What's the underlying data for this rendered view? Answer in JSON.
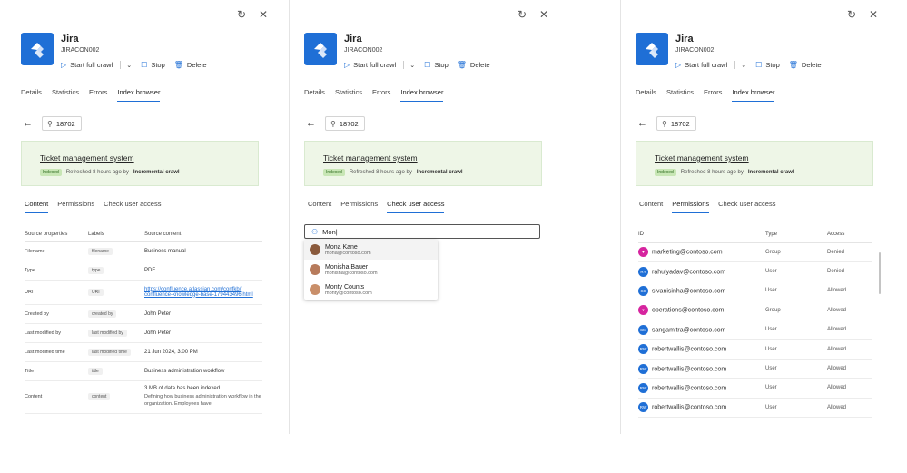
{
  "app": {
    "title": "Jira",
    "id": "JIRACON002",
    "actions": {
      "start_crawl": "Start full crawl",
      "stop": "Stop",
      "delete": "Delete"
    },
    "tabs": [
      "Details",
      "Statistics",
      "Errors",
      "Index browser"
    ],
    "active_tab": "Index browser"
  },
  "search": {
    "value": "18702"
  },
  "document": {
    "title": "Ticket management system",
    "badge": "Indexed",
    "refreshed": "Refreshed 8 hours ago by",
    "crawl": "Incremental crawl"
  },
  "subtabs": [
    "Content",
    "Permissions",
    "Check user access"
  ],
  "content_table": {
    "headers": [
      "Source properties",
      "Labels",
      "Source content"
    ],
    "rows": [
      {
        "prop": "Filename",
        "label": "filename",
        "value": "Business manual"
      },
      {
        "prop": "Type",
        "label": "type",
        "value": "PDF"
      },
      {
        "prop": "URI",
        "label": "URI",
        "value": "https://confluence.atlassian.com/confkb/confluence-knowledge-base-179443496.html",
        "value_line1": "https://confluence.atlassian.com/confkb/",
        "value_line2": "confluence-knowledge-base-179443496.html"
      },
      {
        "prop": "Created by",
        "label": "created by",
        "value": "John Peter"
      },
      {
        "prop": "Last modified by",
        "label": "last modified by",
        "value": "John Peter"
      },
      {
        "prop": "Last modified time",
        "label": "last modified time",
        "value": "21 Jun 2024, 3:00 PM"
      },
      {
        "prop": "Title",
        "label": "title",
        "value": "Business administration workflow"
      },
      {
        "prop": "Content",
        "label": "content",
        "value": "3 MB of data has been indexed",
        "desc": "Defining how business administration workflow in the organization. Employees have"
      }
    ]
  },
  "user_access": {
    "input_value": "Mon|",
    "suggestions": [
      {
        "name": "Mona Kane",
        "email": "mona@contoso.com"
      },
      {
        "name": "Monisha Bauer",
        "email": "monisha@contoso.com"
      },
      {
        "name": "Monty Counts",
        "email": "monty@contoso.com"
      }
    ]
  },
  "permissions": {
    "headers": [
      "ID",
      "Type",
      "Access"
    ],
    "rows": [
      {
        "id": "marketing@contoso.com",
        "initials": "",
        "type": "Group",
        "access": "Denied",
        "color": "#d6249f"
      },
      {
        "id": "rahulyadav@contoso.com",
        "initials": "RY",
        "type": "User",
        "access": "Denied",
        "color": "#1f6fd6"
      },
      {
        "id": "sivanisinha@contoso.com",
        "initials": "SS",
        "type": "User",
        "access": "Allowed",
        "color": "#1f6fd6"
      },
      {
        "id": "operations@contoso.com",
        "initials": "",
        "type": "Group",
        "access": "Allowed",
        "color": "#d6249f"
      },
      {
        "id": "sangamitra@contoso.com",
        "initials": "SM",
        "type": "User",
        "access": "Allowed",
        "color": "#1f6fd6"
      },
      {
        "id": "robertwallis@contoso.com",
        "initials": "RW",
        "type": "User",
        "access": "Allowed",
        "color": "#1f6fd6"
      },
      {
        "id": "robertwallis@contoso.com",
        "initials": "RW",
        "type": "User",
        "access": "Allowed",
        "color": "#1f6fd6"
      },
      {
        "id": "robertwallis@contoso.com",
        "initials": "RW",
        "type": "User",
        "access": "Allowed",
        "color": "#1f6fd6"
      },
      {
        "id": "robertwallis@contoso.com",
        "initials": "RW",
        "type": "User",
        "access": "Allowed",
        "color": "#1f6fd6"
      }
    ]
  }
}
